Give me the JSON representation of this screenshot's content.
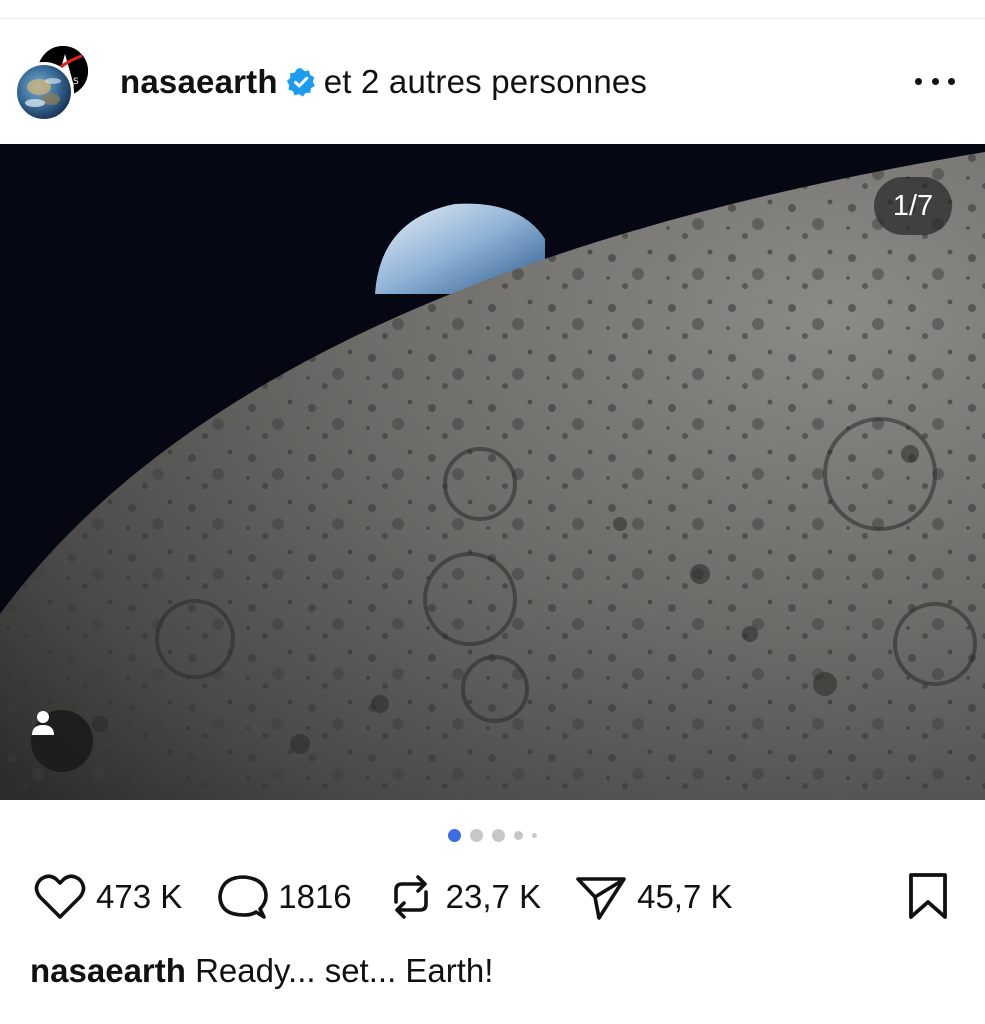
{
  "post": {
    "username": "nasaearth",
    "collaborators_text": "et 2 autres personnes",
    "verified": true,
    "verified_color": "#1d9bf0"
  },
  "media": {
    "counter": "1/7",
    "current_index": 1,
    "total": 7,
    "image_description_icon": "person-tag-icon"
  },
  "carousel": {
    "active_dot_color": "#3f6de0",
    "inactive_dot_color": "#c7c7c7"
  },
  "actions": {
    "likes": "473 K",
    "comments": "1816",
    "reposts": "23,7 K",
    "shares": "45,7 K"
  },
  "caption": {
    "username": "nasaearth",
    "text": "Ready... set... Earth!"
  }
}
